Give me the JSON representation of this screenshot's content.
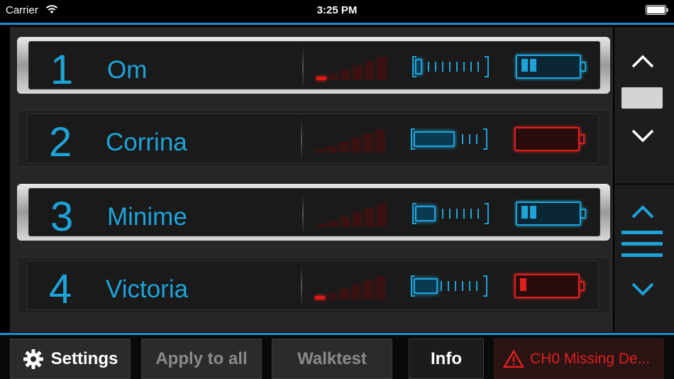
{
  "status_bar": {
    "carrier": "Carrier",
    "time": "3:25 PM"
  },
  "colors": {
    "accent": "#1ea3d9",
    "alert": "#e02020",
    "separator_line": "#1a8fd4"
  },
  "devices": [
    {
      "number": "1",
      "name": "Om",
      "selected": true,
      "signal_bars_on": 1,
      "link_level": 0.1,
      "battery_color": "blue",
      "battery_cells": 2
    },
    {
      "number": "2",
      "name": "Corrina",
      "selected": false,
      "signal_bars_on": 0,
      "link_level": 0.6,
      "battery_color": "red",
      "battery_cells": 0
    },
    {
      "number": "3",
      "name": "Minime",
      "selected": true,
      "signal_bars_on": 0,
      "link_level": 0.3,
      "battery_color": "blue",
      "battery_cells": 2
    },
    {
      "number": "4",
      "name": "Victoria",
      "selected": false,
      "signal_bars_on": 1,
      "link_level": 0.35,
      "battery_color": "red",
      "battery_cells": 1
    }
  ],
  "right_panel": {
    "icons": [
      "chevron-up-icon",
      "chevron-down-icon",
      "chevron-up-icon",
      "list-menu-icon",
      "chevron-down-icon"
    ]
  },
  "toolbar": {
    "settings_label": "Settings",
    "apply_all_label": "Apply to all",
    "walktest_label": "Walktest",
    "info_label": "Info",
    "alert_text": "CH0 Missing De..."
  }
}
